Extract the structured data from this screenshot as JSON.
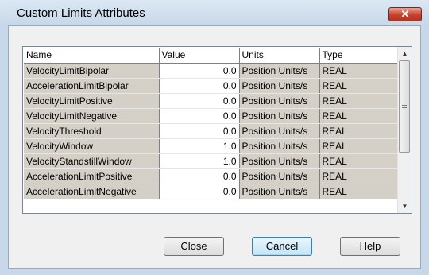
{
  "window": {
    "title": "Custom Limits Attributes",
    "close_glyph": "✕"
  },
  "grid": {
    "headers": [
      "Name",
      "Value",
      "Units",
      "Type"
    ],
    "rows": [
      {
        "name": "VelocityLimitBipolar",
        "value": "0.0",
        "units": "Position Units/s",
        "type": "REAL"
      },
      {
        "name": "AccelerationLimitBipolar",
        "value": "0.0",
        "units": "Position Units/s",
        "type": "REAL"
      },
      {
        "name": "VelocityLimitPositive",
        "value": "0.0",
        "units": "Position Units/s",
        "type": "REAL"
      },
      {
        "name": "VelocityLimitNegative",
        "value": "0.0",
        "units": "Position Units/s",
        "type": "REAL"
      },
      {
        "name": "VelocityThreshold",
        "value": "0.0",
        "units": "Position Units/s",
        "type": "REAL"
      },
      {
        "name": "VelocityWindow",
        "value": "1.0",
        "units": "Position Units/s",
        "type": "REAL"
      },
      {
        "name": "VelocityStandstillWindow",
        "value": "1.0",
        "units": "Position Units/s",
        "type": "REAL"
      },
      {
        "name": "AccelerationLimitPositive",
        "value": "0.0",
        "units": "Position Units/s",
        "type": "REAL"
      },
      {
        "name": "AccelerationLimitNegative",
        "value": "0.0",
        "units": "Position Units/s",
        "type": "REAL"
      }
    ],
    "scroll_up_glyph": "▲",
    "scroll_down_glyph": "▼"
  },
  "buttons": {
    "close": "Close",
    "cancel": "Cancel",
    "help": "Help"
  }
}
